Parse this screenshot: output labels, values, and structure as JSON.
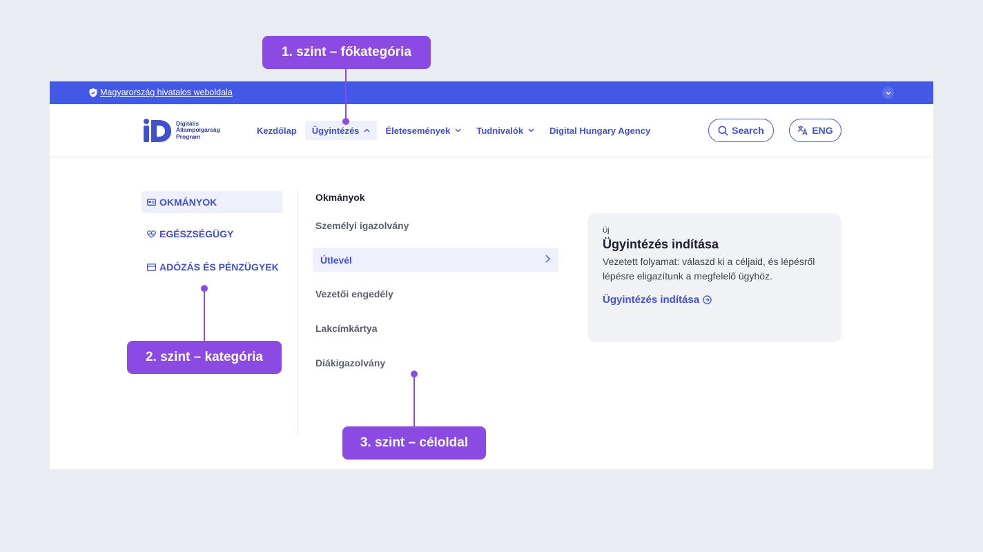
{
  "gov_banner": {
    "text": "Magyarország hivatalos weboldala"
  },
  "logo": {
    "line1": "Digitális",
    "line2": "Állampolgárság",
    "line3": "Program"
  },
  "nav": {
    "items": [
      {
        "label": "Kezdőlap"
      },
      {
        "label": "Ügyintézés"
      },
      {
        "label": "Életesemények"
      },
      {
        "label": "Tudnivalók"
      },
      {
        "label": "Digital Hungary Agency"
      }
    ],
    "search_label": "Search",
    "lang_label": "ENG"
  },
  "categories": [
    {
      "label": "OKMÁNYOK"
    },
    {
      "label": "EGÉSZSÉGÜGY"
    },
    {
      "label": "ADÓZÁS ÉS PÉNZÜGYEK"
    }
  ],
  "subpanel": {
    "title": "Okmányok",
    "items": [
      {
        "label": "Személyi igazolvány"
      },
      {
        "label": "Útlevél"
      },
      {
        "label": "Vezetői engedély"
      },
      {
        "label": "Lakcímkártya"
      },
      {
        "label": "Diákigazolvány"
      }
    ]
  },
  "card": {
    "badge": "Új",
    "title": "Ügyintézés indítása",
    "description": "Vezetett folyamat: válaszd ki a céljaid, és lépésről lépésre eligazítunk a megfelelő ügyhöz.",
    "link": "Ügyintézés indítása"
  },
  "annotations": [
    {
      "label": "1. szint – főkategória"
    },
    {
      "label": "2. szint – kategória"
    },
    {
      "label": "3. szint – céloldal"
    }
  ],
  "colors": {
    "brand": "#3f51cf",
    "banner": "#4259e8",
    "annotation": "#8b4ae4",
    "background": "#e9ecf1"
  }
}
